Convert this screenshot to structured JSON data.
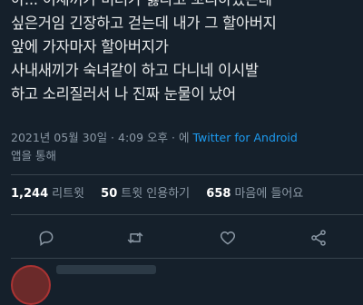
{
  "tweet": {
    "lines": [
      "아... 이새끼가 미러가 싫다고 꼬리하였는데",
      "싶은거임 긴장하고 걷는데 내가 그 할아버지",
      "앞에 가자마자 할아버지가",
      "사내새끼가 숙녀같이 하고 다니네 이시발",
      "하고 소리질러서 나 진짜 눈물이 났어"
    ],
    "timestamp": "2021년 05월 30일 · 4:09 오후 · 에",
    "source": "Twitter for Android",
    "via": "앱을 통해"
  },
  "stats": {
    "retweets_count": "1,244",
    "retweets_label": "리트윗",
    "quotes_count": "50",
    "quotes_label": "트윗 인용하기",
    "likes_count": "658",
    "likes_label": "마음에 들어요"
  },
  "actions": [
    "reply-icon",
    "retweet-icon",
    "like-icon",
    "share-icon"
  ],
  "colors": {
    "background": "#15202b",
    "text": "#e7e9ea",
    "muted": "#8b98a5",
    "link": "#1d9bf0",
    "divider": "#38444d"
  }
}
